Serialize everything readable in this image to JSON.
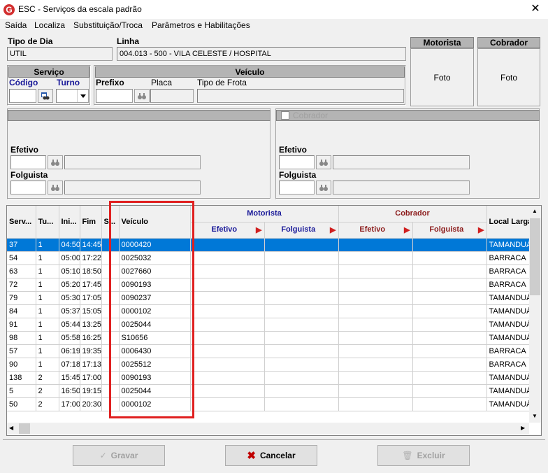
{
  "window": {
    "title": "ESC - Serviços da escala padrão",
    "logo": "G",
    "close_glyph": "✕"
  },
  "menu": [
    "Saída",
    "Localiza",
    "Substituição/Troca",
    "Parâmetros e Habilitações"
  ],
  "top": {
    "tipo_dia_label": "Tipo de Dia",
    "tipo_dia_value": "UTIL",
    "linha_label": "Linha",
    "linha_value": "004.013 - 500 - VILA CELESTE / HOSPITAL",
    "motorista_label": "Motorista",
    "motorista_foto": "Foto",
    "cobrador_label": "Cobrador",
    "cobrador_foto": "Foto"
  },
  "servico": {
    "header": "Serviço",
    "codigo_label": "Código",
    "turno_label": "Turno"
  },
  "veiculo": {
    "header": "Veículo",
    "prefixo_label": "Prefixo",
    "placa_label": "Placa",
    "tipo_frota_label": "Tipo de Frota"
  },
  "left_panel": {
    "efetivo_label": "Efetivo",
    "folguista_label": "Folguista"
  },
  "right_panel": {
    "cobrador_checkbox_label": "Cobrador",
    "efetivo_label": "Efetivo",
    "folguista_label": "Folguista"
  },
  "grid": {
    "columns": {
      "serv": "Serv...",
      "tu": "Tu...",
      "ini": "Ini...",
      "fim": "Fim",
      "s": "S...",
      "veiculo": "Veículo",
      "motorista_group": "Motorista",
      "cobrador_group": "Cobrador",
      "efetivo": "Efetivo",
      "folguista": "Folguista",
      "local": "Local Largad"
    },
    "rows": [
      [
        "37",
        "1",
        "04:50",
        "14:45",
        "",
        "0000420",
        "TAMANDUÁ"
      ],
      [
        "54",
        "1",
        "05:00",
        "17:22",
        "",
        "0025032",
        "BARRACA"
      ],
      [
        "63",
        "1",
        "05:10",
        "18:50",
        "",
        "0027660",
        "BARRACA"
      ],
      [
        "72",
        "1",
        "05:20",
        "17:45",
        "",
        "0090193",
        "BARRACA"
      ],
      [
        "79",
        "1",
        "05:30",
        "17:05",
        "",
        "0090237",
        "TAMANDUÁ"
      ],
      [
        "84",
        "1",
        "05:37",
        "15:05",
        "",
        "0000102",
        "TAMANDUÁ"
      ],
      [
        "91",
        "1",
        "05:44",
        "13:25",
        "",
        "0025044",
        "TAMANDUÁ"
      ],
      [
        "98",
        "1",
        "05:58",
        "16:25",
        "",
        "S10656",
        "TAMANDUÁ"
      ],
      [
        "57",
        "1",
        "06:19",
        "19:35",
        "",
        "0006430",
        "BARRACA"
      ],
      [
        "90",
        "1",
        "07:18",
        "17:13",
        "",
        "0025512",
        "BARRACA"
      ],
      [
        "138",
        "2",
        "15:45",
        "17:00",
        "",
        "0090193",
        "TAMANDUÁ"
      ],
      [
        "5",
        "2",
        "16:50",
        "19:15",
        "",
        "0025044",
        "TAMANDUÁ"
      ],
      [
        "50",
        "2",
        "17:00",
        "20:30",
        "",
        "0000102",
        "TAMANDUÁ"
      ]
    ],
    "selected_row": 0
  },
  "footer": {
    "gravar": "Gravar",
    "cancelar": "Cancelar",
    "excluir": "Excluir"
  },
  "colors": {
    "selection": "#0078d7",
    "motorista_header": "#1a1a99",
    "cobrador_header": "#8b1a1a",
    "highlight_box": "#e02020"
  }
}
